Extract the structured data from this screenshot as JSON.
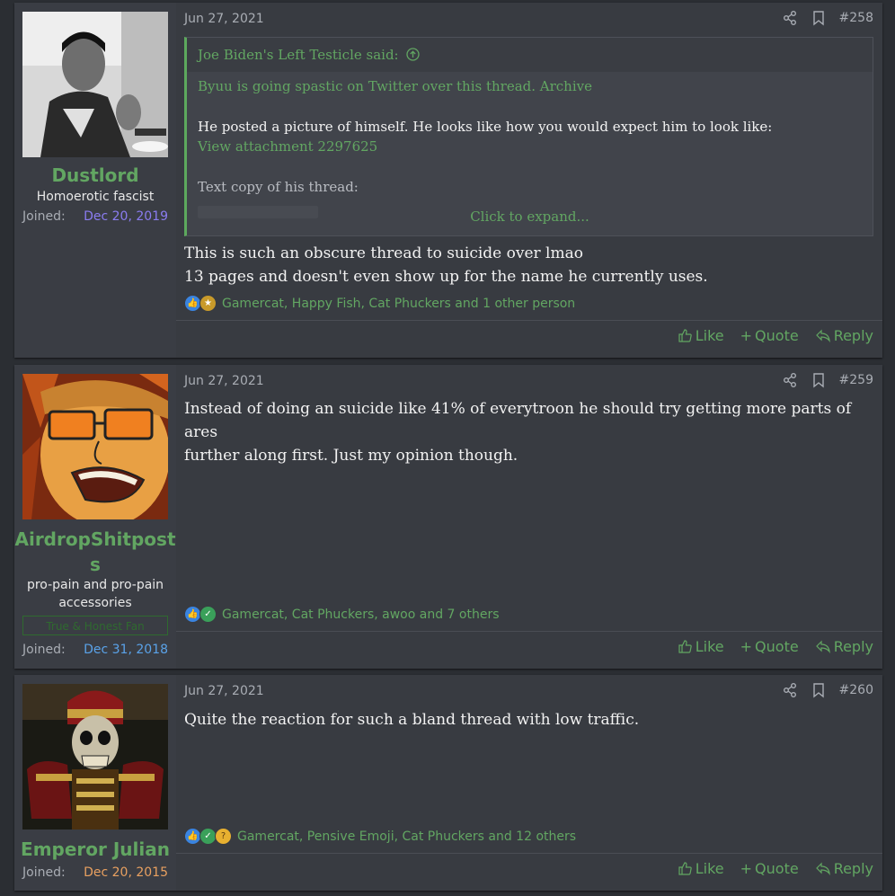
{
  "posts": [
    {
      "username": "Dustlord",
      "user_title": "Homoerotic fascist",
      "joined_label": "Joined:",
      "joined_date": "Dec 20, 2019",
      "joined_color": "#8a7cf0",
      "date": "Jun 27, 2021",
      "number": "#258",
      "quote": {
        "author": "Joe Biden's Left Testicle said:",
        "line1": "Byuu is going spastic on Twitter over this thread. Archive",
        "line2": "He posted a picture of himself. He looks like how you would expect him to look like:",
        "line3": "View attachment 2297625",
        "line4": "Text copy of his thread:",
        "expand": "Click to expand..."
      },
      "body": [
        "This is such an obscure thread to suicide over lmao",
        "13 pages and doesn't even show up for the name he currently uses."
      ],
      "reactions_text": "Gamercat, Happy Fish, Cat Phuckers and 1 other person",
      "actions": {
        "like": "Like",
        "quote": "Quote",
        "reply": "Reply"
      }
    },
    {
      "username_line1": "AirdropShitpost",
      "username_line2": "s",
      "user_title_line1": "pro-pain and pro-pain",
      "user_title_line2": "accessories",
      "banner": "True & Honest Fan",
      "joined_label": "Joined:",
      "joined_date": "Dec 31, 2018",
      "joined_color": "#5aa2e8",
      "date": "Jun 27, 2021",
      "number": "#259",
      "body": [
        "Instead of doing an suicide like 41% of everytroon he should try getting more parts of ares",
        "further along first. Just my opinion though."
      ],
      "reactions_text": "Gamercat, Cat Phuckers, awoo and 7 others",
      "actions": {
        "like": "Like",
        "quote": "Quote",
        "reply": "Reply"
      }
    },
    {
      "username": "Emperor Julian",
      "joined_label": "Joined:",
      "joined_date": "Dec 20, 2015",
      "joined_color": "#e8a060",
      "date": "Jun 27, 2021",
      "number": "#260",
      "body": [
        "Quite the reaction for such a bland thread with low traffic."
      ],
      "reactions_text": "Gamercat, Pensive Emoji, Cat Phuckers and 12 others",
      "actions": {
        "like": "Like",
        "quote": "Quote",
        "reply": "Reply"
      }
    }
  ]
}
